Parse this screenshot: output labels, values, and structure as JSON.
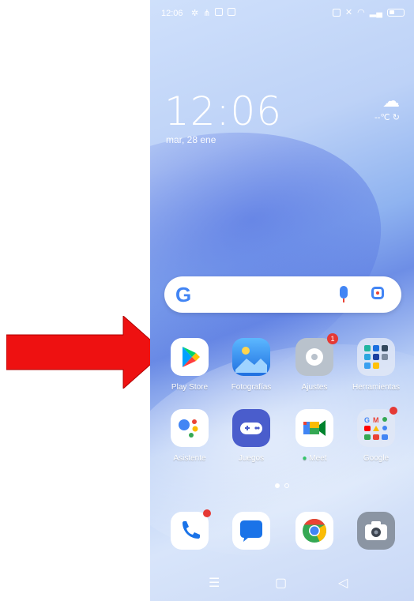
{
  "status_bar": {
    "time": "12:06"
  },
  "lock_clock": {
    "time": "12:06",
    "date": "mar, 28 ene"
  },
  "weather": {
    "temp": "--℃",
    "icon": "cloud-sun-icon"
  },
  "search": {
    "logo": "G"
  },
  "apps_row1": [
    {
      "label": "Play Store",
      "icon": "play-store-icon",
      "color": "#ffffff"
    },
    {
      "label": "Fotografías",
      "icon": "photos-icon",
      "color": "#2d8cf0"
    },
    {
      "label": "Ajustes",
      "icon": "settings-icon",
      "color": "#b9c2cc",
      "badge": "1"
    },
    {
      "label": "Herramientas",
      "icon": "tools-folder-icon",
      "color": "#dfe7f5"
    }
  ],
  "apps_row2": [
    {
      "label": "Asistente",
      "icon": "assistant-icon",
      "color": "#ffffff"
    },
    {
      "label": "Juegos",
      "icon": "games-icon",
      "color": "#4a5dcc"
    },
    {
      "label": "Meet",
      "icon": "meet-icon",
      "color": "#ffffff"
    },
    {
      "label": "Google",
      "icon": "google-folder-icon",
      "color": "#dfe7f5"
    }
  ],
  "dock": [
    {
      "icon": "phone-icon",
      "color": "#ffffff"
    },
    {
      "icon": "messages-icon",
      "color": "#ffffff"
    },
    {
      "icon": "chrome-icon",
      "color": "#ffffff"
    },
    {
      "icon": "camera-icon",
      "color": "#8b95a3"
    }
  ],
  "nav": {
    "menu": "☰",
    "home": "▢",
    "back": "◁"
  },
  "annotation": {
    "arrow_color": "#ee1111"
  }
}
